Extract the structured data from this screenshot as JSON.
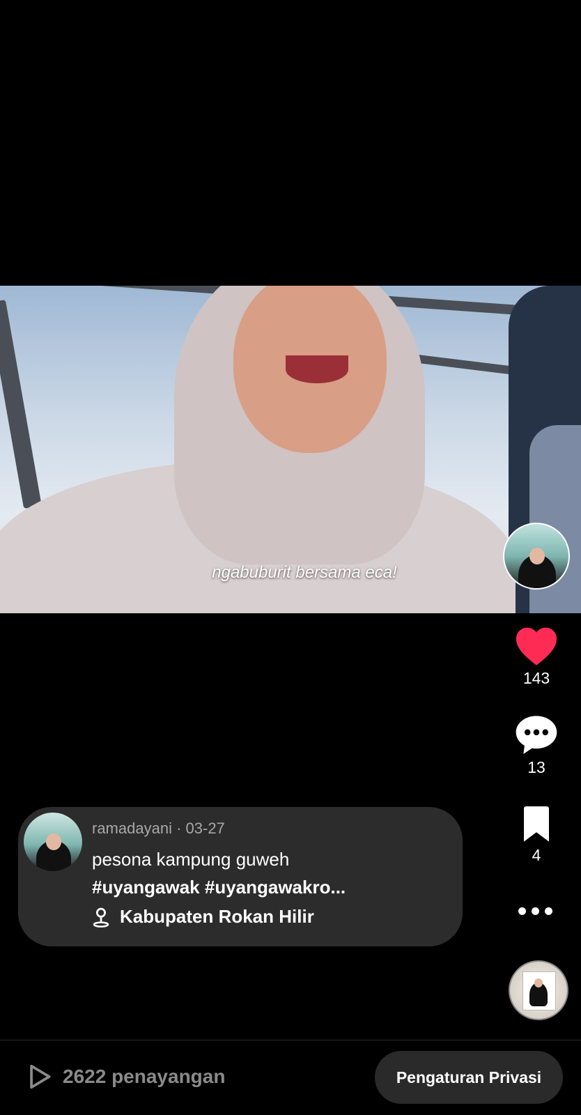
{
  "video": {
    "caption_overlay": "ngabuburit bersama eca!"
  },
  "right_rail": {
    "like_count": "143",
    "comment_count": "13",
    "save_count": "4",
    "like_color": "#fe2c55",
    "icons": [
      "profile-avatar",
      "heart-icon",
      "comment-icon",
      "bookmark-icon",
      "more-icon",
      "music-disc-icon"
    ]
  },
  "post_info": {
    "username": "ramadayani",
    "separator": " · ",
    "date": "03-27",
    "description": "pesona kampung guweh",
    "hashtags": "#uyangawak #uyangawakro...",
    "location": "Kabupaten Rokan Hilir"
  },
  "footer": {
    "views": "2622 penayangan",
    "privacy_button": "Pengaturan Privasi"
  }
}
